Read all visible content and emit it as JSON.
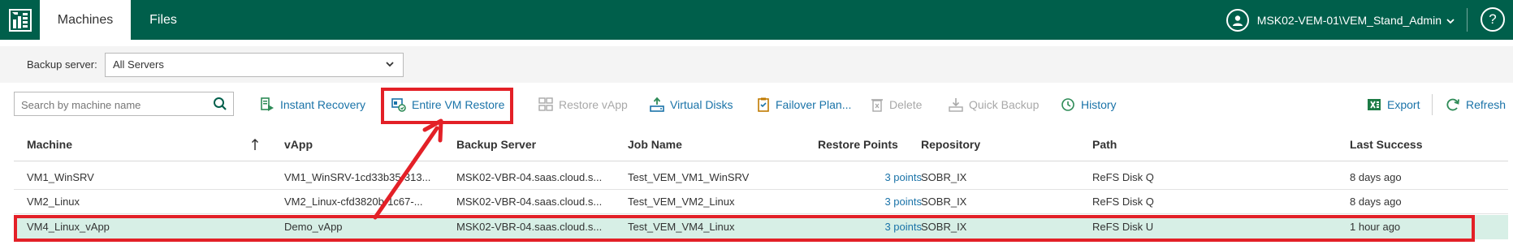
{
  "header": {
    "tabs": [
      {
        "label": "Machines",
        "active": true
      },
      {
        "label": "Files",
        "active": false
      }
    ],
    "user": "MSK02-VEM-01\\VEM_Stand_Admin",
    "help_label": "?"
  },
  "filter": {
    "backup_server_label": "Backup server:",
    "backup_server_value": "All Servers"
  },
  "toolbar": {
    "search_placeholder": "Search by machine name",
    "instant_recovery": "Instant Recovery",
    "entire_vm_restore": "Entire VM Restore",
    "restore_vapp": "Restore vApp",
    "virtual_disks": "Virtual Disks",
    "failover_plan": "Failover Plan...",
    "delete": "Delete",
    "quick_backup": "Quick Backup",
    "history": "History",
    "export": "Export",
    "refresh": "Refresh"
  },
  "grid": {
    "columns": [
      "Machine",
      "vApp",
      "Backup Server",
      "Job Name",
      "Restore Points",
      "Repository",
      "Path",
      "Last Success"
    ],
    "rows": [
      {
        "machine": "VM1_WinSRV",
        "vapp": "VM1_WinSRV-1cd33b35-313...",
        "backup_server": "MSK02-VBR-04.saas.cloud.s...",
        "job_name": "Test_VEM_VM1_WinSRV",
        "restore_points": "3 points",
        "repository": "SOBR_IX",
        "path": "ReFS Disk Q",
        "last_success": "8 days ago",
        "selected": false
      },
      {
        "machine": "VM2_Linux",
        "vapp": "VM2_Linux-cfd3820b-1c67-...",
        "backup_server": "MSK02-VBR-04.saas.cloud.s...",
        "job_name": "Test_VEM_VM2_Linux",
        "restore_points": "3 points",
        "repository": "SOBR_IX",
        "path": "ReFS Disk Q",
        "last_success": "8 days ago",
        "selected": false
      },
      {
        "machine": "VM4_Linux_vApp",
        "vapp": "Demo_vApp",
        "backup_server": "MSK02-VBR-04.saas.cloud.s...",
        "job_name": "Test_VEM_VM4_Linux",
        "restore_points": "3 points",
        "repository": "SOBR_IX",
        "path": "ReFS Disk U",
        "last_success": "1 hour ago",
        "selected": true
      }
    ]
  },
  "colors": {
    "brand": "#005f4b",
    "link": "#1a73a8",
    "highlight": "#e32027",
    "selected_row": "#d7efe6"
  },
  "icons": [
    "veeam-logo-icon",
    "user-avatar-icon",
    "chevron-down-icon",
    "help-icon",
    "search-icon",
    "instant-recovery-icon",
    "entire-vm-restore-icon",
    "restore-vapp-icon",
    "virtual-disks-icon",
    "failover-plan-icon",
    "delete-icon",
    "quick-backup-icon",
    "history-icon",
    "export-excel-icon",
    "refresh-icon",
    "sort-ascending-icon"
  ]
}
